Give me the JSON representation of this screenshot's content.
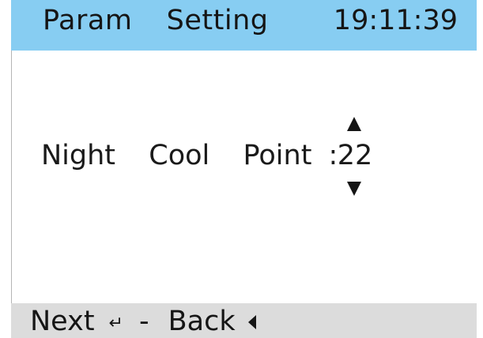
{
  "header": {
    "title": "Param  Setting",
    "time": "19:11:39",
    "background_color": "#87cdf2"
  },
  "parameter": {
    "label": "Night  Cool  Point :",
    "value": "22",
    "up_icon": "triangle-up-icon",
    "down_icon": "triangle-down-icon"
  },
  "footer": {
    "next_label": "Next",
    "enter_icon": "↵",
    "separator": "-",
    "back_label": "Back",
    "back_icon": "triangle-left-icon",
    "background_color": "#dcdcdc"
  }
}
